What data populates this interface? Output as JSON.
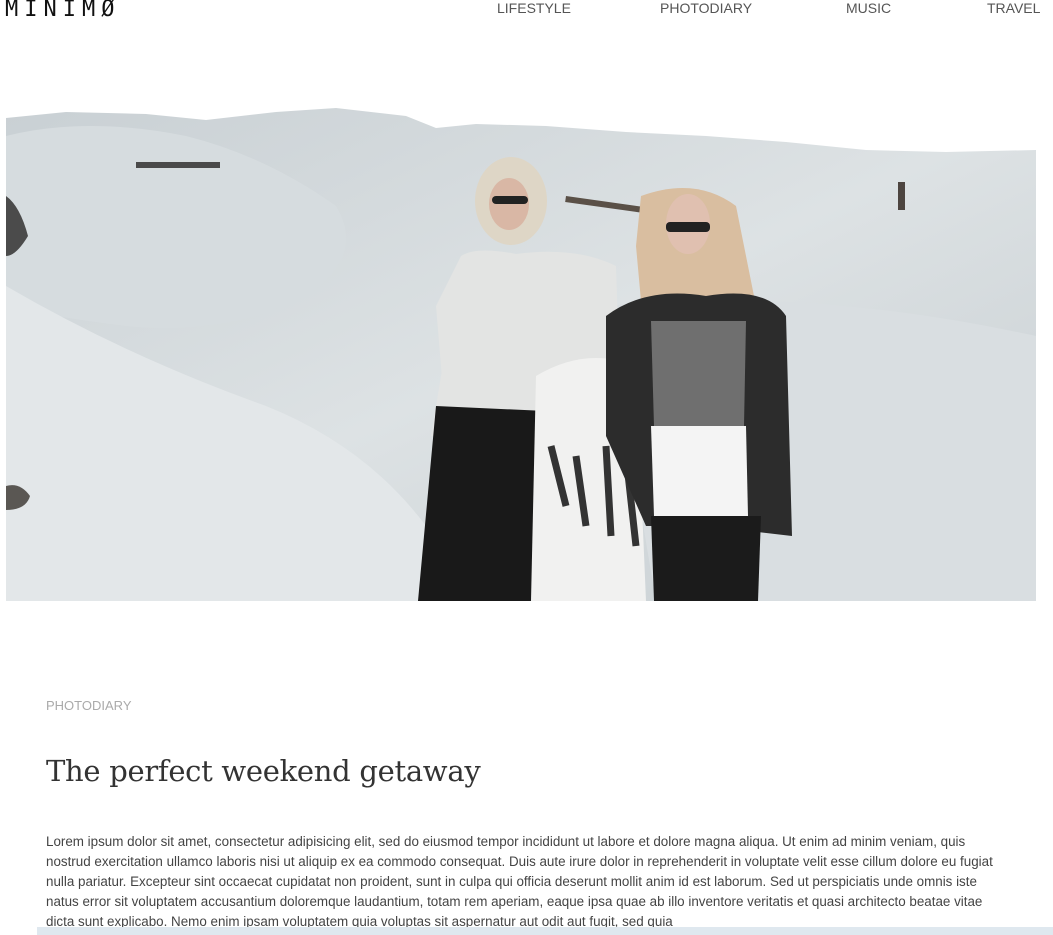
{
  "brand": {
    "logo": "MINIMØ"
  },
  "nav": {
    "items": [
      {
        "label": "LIFESTYLE"
      },
      {
        "label": "PHOTODIARY"
      },
      {
        "label": "MUSIC"
      },
      {
        "label": "TRAVEL"
      }
    ]
  },
  "hero": {
    "icon": "photo-two-women-dunes"
  },
  "article": {
    "category": "PHOTODIARY",
    "title": "The perfect weekend getaway",
    "body": "Lorem ipsum dolor sit amet, consectetur adipisicing elit, sed do eiusmod tempor incididunt ut labore et dolore magna aliqua. Ut enim ad minim veniam, quis nostrud exercitation ullamco laboris nisi ut aliquip ex ea commodo consequat. Duis aute irure dolor in reprehenderit in voluptate velit esse cillum dolore eu fugiat nulla pariatur. Excepteur sint occaecat cupidatat non proident, sunt in culpa qui officia deserunt mollit anim id est laborum. Sed ut perspiciatis unde omnis iste natus error sit voluptatem accusantium doloremque laudantium, totam rem aperiam, eaque ipsa quae ab illo inventore veritatis et quasi architecto beatae vitae dicta sunt explicabo. Nemo enim ipsam voluptatem quia voluptas sit aspernatur aut odit aut fugit, sed quia"
  },
  "colors": {
    "accent": "#dfe8ef",
    "text": "#333333",
    "muted": "#aaaaaa"
  }
}
